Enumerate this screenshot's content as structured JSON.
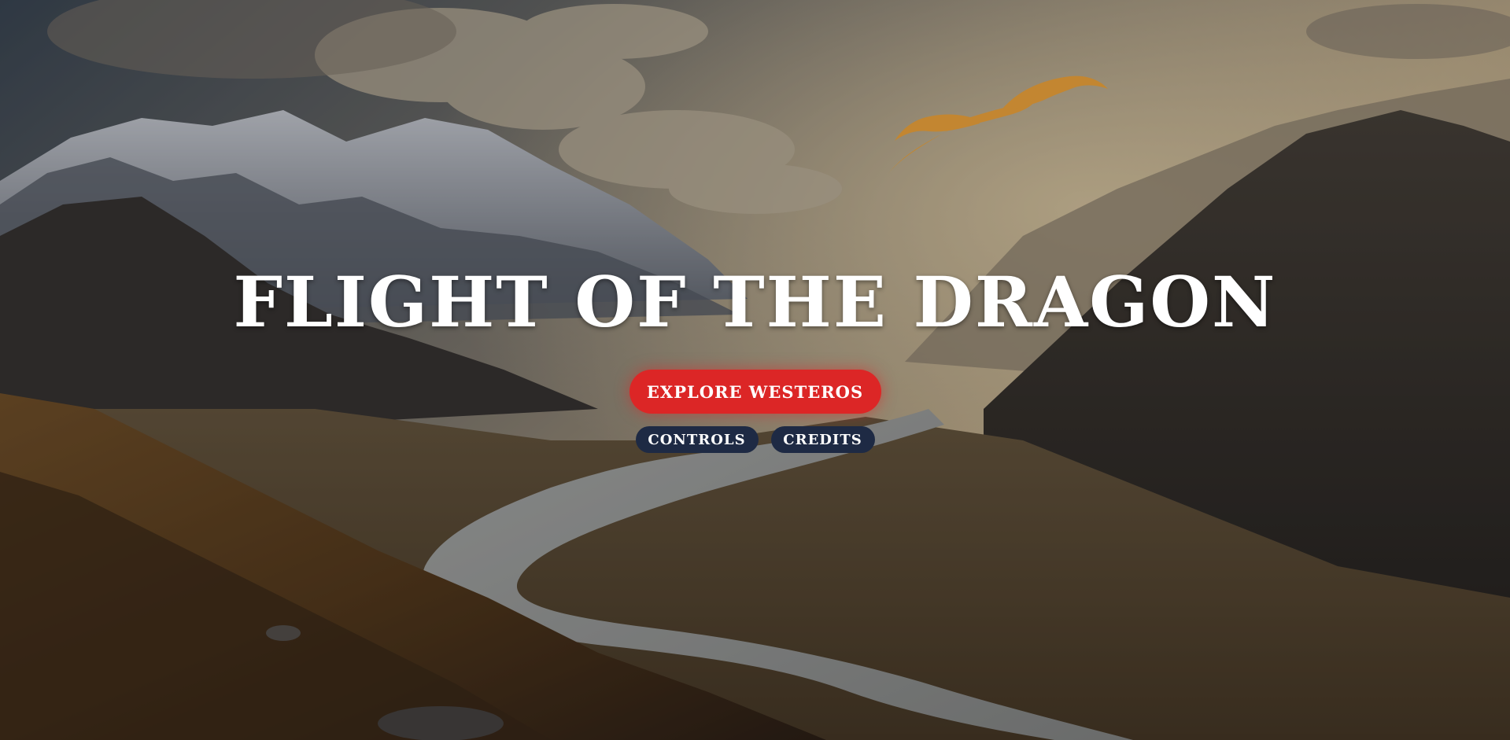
{
  "hero": {
    "title": "FLIGHT OF THE DRAGON"
  },
  "buttons": {
    "explore_label": "EXPLORE WESTEROS",
    "controls_label": "CONTROLS",
    "credits_label": "CREDITS"
  },
  "colors": {
    "primary_button": "#dc2626",
    "secondary_button": "#1e2a44",
    "title_text": "#ffffff"
  },
  "icons": {
    "dragon": "dragon-silhouette-icon"
  }
}
